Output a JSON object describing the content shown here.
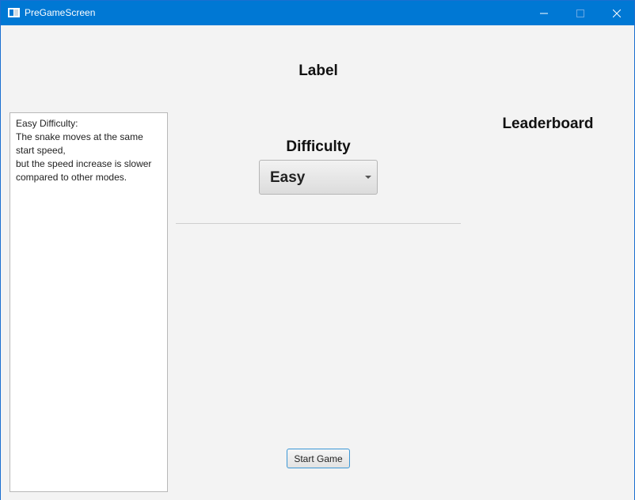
{
  "window": {
    "title": "PreGameScreen"
  },
  "main": {
    "label": "Label",
    "difficulty_heading": "Difficulty",
    "difficulty_selected": "Easy",
    "leaderboard_heading": "Leaderboard",
    "info_text": "Easy Difficulty:\nThe snake moves at the same start speed,\nbut the speed increase is slower compared to other modes.",
    "start_button": "Start Game"
  },
  "colors": {
    "titlebar": "#0078d4",
    "background": "#f3f3f3",
    "button_focus_border": "#3b97d6"
  }
}
